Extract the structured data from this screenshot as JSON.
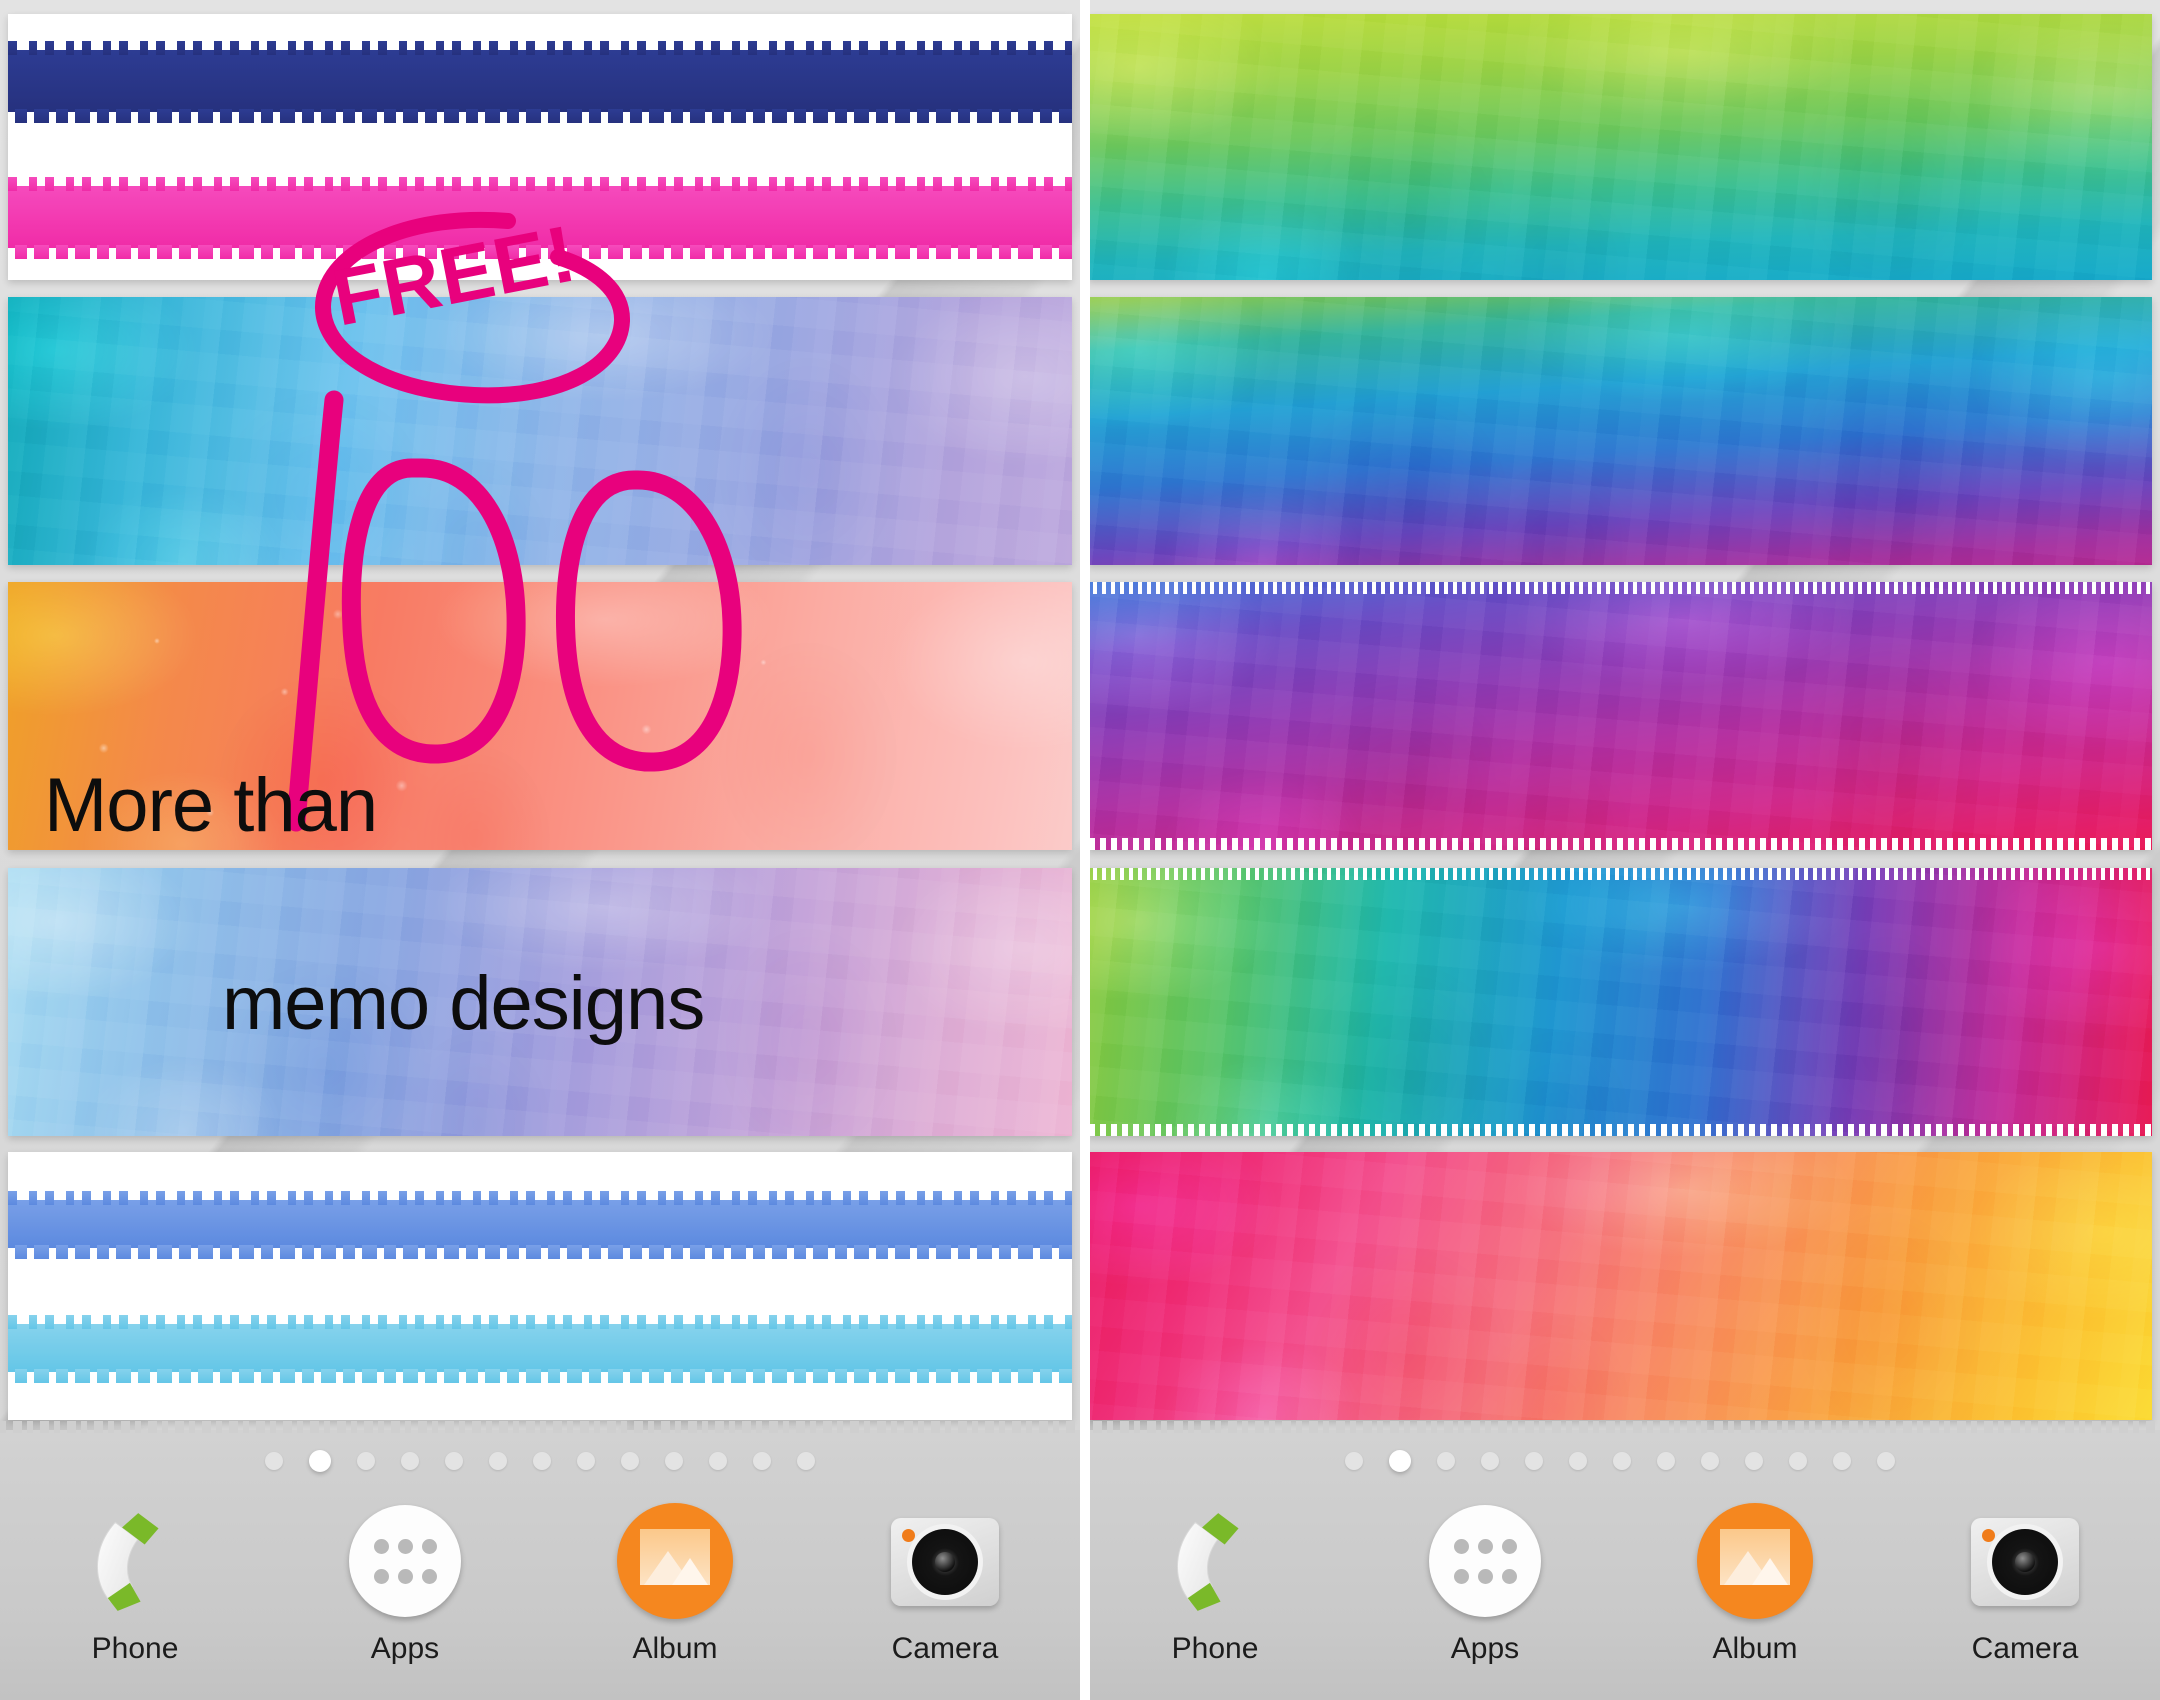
{
  "app": {
    "title": "Watercolor Memo Widget Home Screen",
    "screens": 2
  },
  "promo": {
    "free_badge": "FREE!",
    "headline_prefix": "More than",
    "headline_number": "100",
    "headline_suffix": "memo designs",
    "accent_color": "#e8017d",
    "text_color": "#0d0d0d"
  },
  "left_screen": {
    "name": "home-screen-left",
    "memo_widgets": [
      {
        "id": "memo-navy-pink-lines",
        "style": "white-paper-with-bands",
        "paper": "#ffffff",
        "bands": [
          {
            "color": "#2a3a8f",
            "label": "navy-brush-band"
          },
          {
            "color": "#f51fae",
            "label": "pink-brush-band"
          }
        ]
      },
      {
        "id": "memo-teal-blue-lavender",
        "style": "full-watercolor",
        "colors": [
          "#12a8b4",
          "#58b8e8",
          "#8fa8e3",
          "#b6a4dd"
        ]
      },
      {
        "id": "memo-orange-coral-peach",
        "style": "full-watercolor",
        "colors": [
          "#f0a02a",
          "#f77f62",
          "#fa9d8c",
          "#fbb9b4"
        ]
      },
      {
        "id": "memo-sky-lavender-pink",
        "style": "full-watercolor",
        "colors": [
          "#9ad6f0",
          "#8fa5e0",
          "#b3a2dc",
          "#e7aed2"
        ]
      },
      {
        "id": "memo-blue-cyan-lines",
        "style": "white-paper-with-bands",
        "paper": "#ffffff",
        "bands": [
          {
            "color": "#5585e0",
            "label": "blue-brush-band"
          },
          {
            "color": "#5ec4e8",
            "label": "cyan-brush-band"
          }
        ]
      }
    ],
    "page_indicator": {
      "total": 13,
      "active_index": 1
    },
    "dock": [
      {
        "id": "phone",
        "label": "Phone",
        "icon": "phone-handset-icon"
      },
      {
        "id": "apps",
        "label": "Apps",
        "icon": "app-drawer-grid-icon"
      },
      {
        "id": "album",
        "label": "Album",
        "icon": "photo-album-icon"
      },
      {
        "id": "camera",
        "label": "Camera",
        "icon": "camera-icon"
      }
    ]
  },
  "right_screen": {
    "name": "home-screen-right",
    "memo_widgets": [
      {
        "id": "memo-lime-teal",
        "style": "full-watercolor",
        "colors": [
          "#b7d93a",
          "#77c85a",
          "#2bb4a8",
          "#18a6c4"
        ]
      },
      {
        "id": "memo-green-blue-purple",
        "style": "full-watercolor",
        "colors": [
          "#7fc64c",
          "#2a9fd6",
          "#3a63c8",
          "#a0329e"
        ]
      },
      {
        "id": "memo-blue-purple-magenta",
        "style": "full-watercolor",
        "colors": [
          "#3f6fd8",
          "#7b3fb5",
          "#c42a8e",
          "#e8145f"
        ]
      },
      {
        "id": "memo-rainbow-horizontal",
        "style": "full-watercolor",
        "colors": [
          "#86c63f",
          "#23b6b0",
          "#2a7ad4",
          "#8a35b0",
          "#d2269a",
          "#ea1b4c"
        ]
      },
      {
        "id": "memo-pink-orange-yellow",
        "style": "full-watercolor",
        "colors": [
          "#e8175d",
          "#f45a8c",
          "#f8845f",
          "#f9a83a",
          "#fbd933"
        ]
      }
    ],
    "page_indicator": {
      "total": 13,
      "active_index": 1
    },
    "dock": [
      {
        "id": "phone",
        "label": "Phone",
        "icon": "phone-handset-icon"
      },
      {
        "id": "apps",
        "label": "Apps",
        "icon": "app-drawer-grid-icon"
      },
      {
        "id": "album",
        "label": "Album",
        "icon": "photo-album-icon"
      },
      {
        "id": "camera",
        "label": "Camera",
        "icon": "camera-icon"
      }
    ]
  }
}
